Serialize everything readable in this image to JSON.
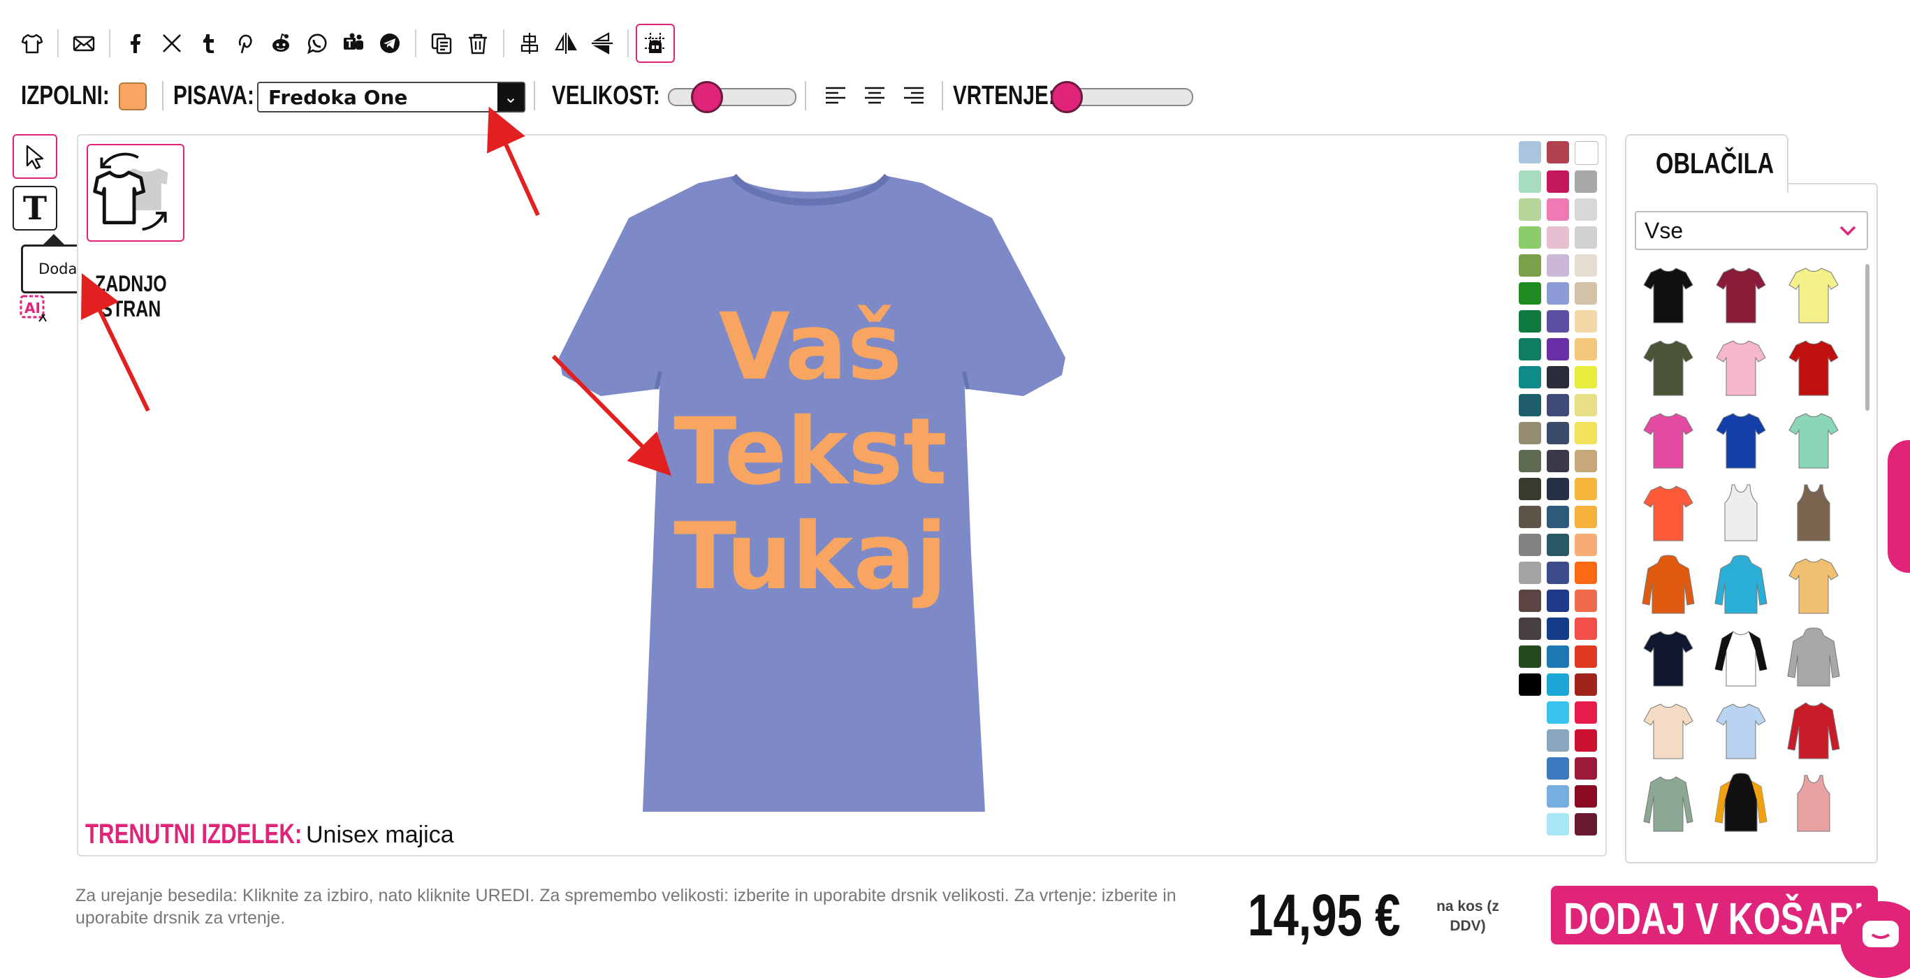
{
  "toolbar": {
    "icons": [
      "tshirt-icon",
      "mail-icon",
      "facebook-icon",
      "x-icon",
      "tumblr-icon",
      "pinterest-icon",
      "reddit-icon",
      "whatsapp-icon",
      "teams-icon",
      "telegram-icon",
      "duplicate-icon",
      "trash-icon",
      "align-center-icon",
      "flip-horizontal-icon",
      "flip-vertical-icon",
      "grid-toggle-icon"
    ]
  },
  "options": {
    "fill_label": "IZPOLNI:",
    "fill_color": "#f7a560",
    "font_label": "PISAVA:",
    "font_value": "Fredoka One",
    "size_label": "VELIKOST:",
    "size_level": 0.22,
    "rotate_label": "VRTENJE:",
    "rotate_level": 0.0
  },
  "tools": {
    "tooltip": "Dodaj besedilo",
    "swap_text_line1": "ZADNJO",
    "swap_text_line2": "STRAN"
  },
  "design": {
    "line1": "Vaš",
    "line2": "Tekst",
    "line3": "Tukaj",
    "shirt_color": "#7d8ac7",
    "text_color": "#f7a560"
  },
  "product": {
    "label": "TRENUTNI IZDELEK:",
    "name": "Unisex majica"
  },
  "palette": [
    "#a9c4dc",
    "#b0414e",
    "#ffffff",
    "#a8dcc0",
    "#c4185c",
    "#a8a8a8",
    "#b7d59a",
    "#ee79b3",
    "#d8d8d8",
    "#8ccc6a",
    "#e6c0d0",
    "#d0d0d0",
    "#7ba04a",
    "#cbb8d8",
    "#e4ddd0",
    "#1f8a20",
    "#8a9bd6",
    "#d3c2a8",
    "#0f7a40",
    "#5b4fa3",
    "#f3d7a6",
    "#0f7d63",
    "#6a2fa6",
    "#f3c87c",
    "#0f8a8a",
    "#2b2c3a",
    "#e8ec3a",
    "#1d5e6a",
    "#404a78",
    "#e8de86",
    "#968c72",
    "#3c4a6a",
    "#f3e25a",
    "#5e6a52",
    "#3a3a4a",
    "#c8a87a",
    "#3a3a2c",
    "#263046",
    "#f6b63c",
    "#5e5448",
    "#2c5a78",
    "#f6b23c",
    "#828282",
    "#285864",
    "#f6ac74",
    "#a4a4a4",
    "#3c4c8a",
    "#fa6a12",
    "#5c4444",
    "#1f3a8a",
    "#ee6a4a",
    "#484040",
    "#143c8a",
    "#f4504a",
    "#254a20",
    "#1c78b0",
    "#e03a24",
    "#000000",
    "#1ca6d6",
    "#a0241a",
    "",
    "#38c2ee",
    "#e81c4a",
    "",
    "#8aa6be",
    "#cc1030",
    "",
    "#3c7abf",
    "#9c1a38",
    "",
    "#76aee0",
    "#8a0a24",
    "",
    "#a8e6f6",
    "#6a1a30"
  ],
  "clothes": {
    "tab_label": "OBLAČILA",
    "category": "Vse",
    "items": [
      {
        "name": "tshirt-black",
        "color": "#111111",
        "type": "tee"
      },
      {
        "name": "tshirt-maroon",
        "color": "#8a1c3a",
        "type": "tee"
      },
      {
        "name": "tshirt-yellow",
        "color": "#f6f08a",
        "type": "tee"
      },
      {
        "name": "tshirt-olive",
        "color": "#4a5436",
        "type": "tee"
      },
      {
        "name": "tshirt-pink",
        "color": "#f6b6cc",
        "type": "tee"
      },
      {
        "name": "tshirt-red",
        "color": "#c01010",
        "type": "tee"
      },
      {
        "name": "tshirt-fuchsia",
        "color": "#e44aa0",
        "type": "tee"
      },
      {
        "name": "tshirt-royal",
        "color": "#1240a8",
        "type": "tee"
      },
      {
        "name": "tshirt-mint",
        "color": "#8ad6b6",
        "type": "tee"
      },
      {
        "name": "tshirt-coral",
        "color": "#ff5a3a",
        "type": "tee"
      },
      {
        "name": "tank-white",
        "color": "#eeeeee",
        "type": "tank"
      },
      {
        "name": "tank-brown",
        "color": "#7a6450",
        "type": "tank"
      },
      {
        "name": "hoodie-orange",
        "color": "#e05a10",
        "type": "hoodie"
      },
      {
        "name": "hoodie-turquoise",
        "color": "#2aaed6",
        "type": "hoodie"
      },
      {
        "name": "tshirt-tiedye",
        "color": "#f0c070",
        "type": "tee"
      },
      {
        "name": "tshirt-navy",
        "color": "#101830",
        "type": "tee"
      },
      {
        "name": "raglan-black-white",
        "color": "#ffffff",
        "type": "raglan"
      },
      {
        "name": "hoodie-grey",
        "color": "#a8a8a8",
        "type": "hoodie"
      },
      {
        "name": "tshirt-natural",
        "color": "#f4dcc4",
        "type": "tee"
      },
      {
        "name": "tshirt-skyfade",
        "color": "#b8d4f0",
        "type": "tee"
      },
      {
        "name": "jacket-red",
        "color": "#c81c28",
        "type": "jacket"
      },
      {
        "name": "longsleeve-sage",
        "color": "#8aa894",
        "type": "long"
      },
      {
        "name": "hoodie-black-orange",
        "color": "#111111",
        "type": "hoodie"
      },
      {
        "name": "tank-salmon",
        "color": "#e8a0a0",
        "type": "tank"
      }
    ]
  },
  "footer": {
    "help": "Za urejanje besedila: Kliknite za izbiro, nato kliknite UREDI. Za spremembo velikosti: izberite in uporabite drsnik velikosti. Za vrtenje: izberite in uporabite drsnik za vrtenje.",
    "price": "14,95 €",
    "per_unit": "na kos (z DDV)",
    "cart_button": "DODAJ V KOŠARICO"
  }
}
